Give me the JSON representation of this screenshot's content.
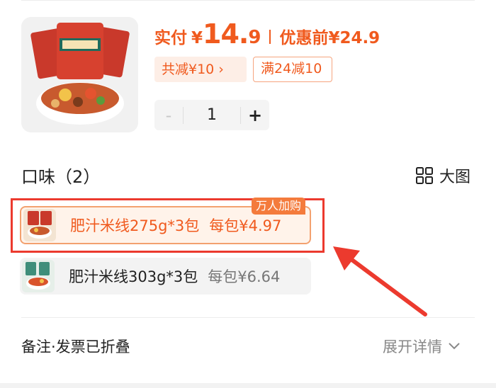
{
  "product": {
    "image_icon": "rice-noodle-product-image",
    "price_label": "实付",
    "currency": "¥",
    "price_int": "14.",
    "price_dec": "9",
    "orig_label": "优惠前",
    "orig_price": "¥24.9",
    "discount_tag": "共减¥10 ›",
    "coupon_tag": "满24减10",
    "quantity": {
      "minus": "-",
      "value": "1",
      "plus": "+"
    }
  },
  "flavor": {
    "title": "口味（2）",
    "big_view_label": "大图",
    "big_view_icon": "grid-icon",
    "options": [
      {
        "name": "肥汁米线275g*3包",
        "per_pack": "每包¥4.97",
        "badge": "万人加购",
        "selected": true
      },
      {
        "name": "肥汁米线303g*3包",
        "per_pack": "每包¥6.64",
        "selected": false
      }
    ]
  },
  "footer": {
    "remark": "备注·发票已折叠",
    "expand": "展开详情",
    "expand_icon": "chevron-down-icon"
  },
  "colors": {
    "accent": "#f05a1e",
    "annotation": "#ec3a2e"
  }
}
